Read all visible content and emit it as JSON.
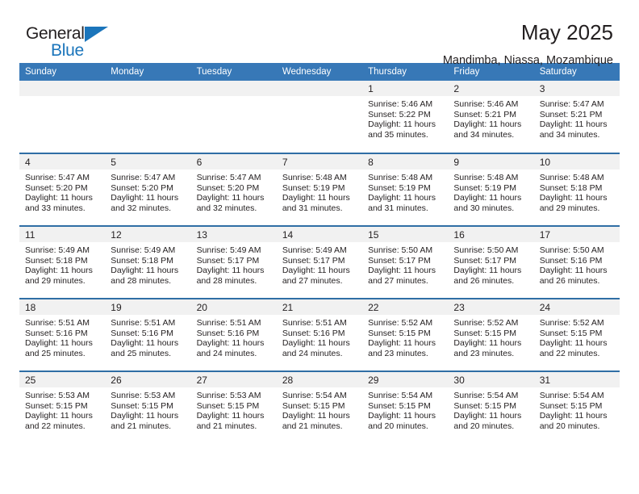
{
  "brand": {
    "name_top": "General",
    "name_bottom": "Blue",
    "accent_color": "#1b75bb"
  },
  "header": {
    "month_title": "May 2025",
    "location": "Mandimba, Niassa, Mozambique"
  },
  "theme": {
    "header_row_bg": "#3778b7",
    "day_number_bg": "#f1f1f1",
    "row_divider": "#2f6ea5",
    "text_color": "#231f20"
  },
  "weekday_headers": [
    "Sunday",
    "Monday",
    "Tuesday",
    "Wednesday",
    "Thursday",
    "Friday",
    "Saturday"
  ],
  "labels": {
    "sunrise_prefix": "Sunrise:",
    "sunset_prefix": "Sunset:",
    "daylight_prefix": "Daylight:"
  },
  "weeks": [
    [
      {
        "day": "",
        "empty": true
      },
      {
        "day": "",
        "empty": true
      },
      {
        "day": "",
        "empty": true
      },
      {
        "day": "",
        "empty": true
      },
      {
        "day": "1",
        "sunrise": "Sunrise: 5:46 AM",
        "sunset": "Sunset: 5:22 PM",
        "daylight": "Daylight: 11 hours and 35 minutes."
      },
      {
        "day": "2",
        "sunrise": "Sunrise: 5:46 AM",
        "sunset": "Sunset: 5:21 PM",
        "daylight": "Daylight: 11 hours and 34 minutes."
      },
      {
        "day": "3",
        "sunrise": "Sunrise: 5:47 AM",
        "sunset": "Sunset: 5:21 PM",
        "daylight": "Daylight: 11 hours and 34 minutes."
      }
    ],
    [
      {
        "day": "4",
        "sunrise": "Sunrise: 5:47 AM",
        "sunset": "Sunset: 5:20 PM",
        "daylight": "Daylight: 11 hours and 33 minutes."
      },
      {
        "day": "5",
        "sunrise": "Sunrise: 5:47 AM",
        "sunset": "Sunset: 5:20 PM",
        "daylight": "Daylight: 11 hours and 32 minutes."
      },
      {
        "day": "6",
        "sunrise": "Sunrise: 5:47 AM",
        "sunset": "Sunset: 5:20 PM",
        "daylight": "Daylight: 11 hours and 32 minutes."
      },
      {
        "day": "7",
        "sunrise": "Sunrise: 5:48 AM",
        "sunset": "Sunset: 5:19 PM",
        "daylight": "Daylight: 11 hours and 31 minutes."
      },
      {
        "day": "8",
        "sunrise": "Sunrise: 5:48 AM",
        "sunset": "Sunset: 5:19 PM",
        "daylight": "Daylight: 11 hours and 31 minutes."
      },
      {
        "day": "9",
        "sunrise": "Sunrise: 5:48 AM",
        "sunset": "Sunset: 5:19 PM",
        "daylight": "Daylight: 11 hours and 30 minutes."
      },
      {
        "day": "10",
        "sunrise": "Sunrise: 5:48 AM",
        "sunset": "Sunset: 5:18 PM",
        "daylight": "Daylight: 11 hours and 29 minutes."
      }
    ],
    [
      {
        "day": "11",
        "sunrise": "Sunrise: 5:49 AM",
        "sunset": "Sunset: 5:18 PM",
        "daylight": "Daylight: 11 hours and 29 minutes."
      },
      {
        "day": "12",
        "sunrise": "Sunrise: 5:49 AM",
        "sunset": "Sunset: 5:18 PM",
        "daylight": "Daylight: 11 hours and 28 minutes."
      },
      {
        "day": "13",
        "sunrise": "Sunrise: 5:49 AM",
        "sunset": "Sunset: 5:17 PM",
        "daylight": "Daylight: 11 hours and 28 minutes."
      },
      {
        "day": "14",
        "sunrise": "Sunrise: 5:49 AM",
        "sunset": "Sunset: 5:17 PM",
        "daylight": "Daylight: 11 hours and 27 minutes."
      },
      {
        "day": "15",
        "sunrise": "Sunrise: 5:50 AM",
        "sunset": "Sunset: 5:17 PM",
        "daylight": "Daylight: 11 hours and 27 minutes."
      },
      {
        "day": "16",
        "sunrise": "Sunrise: 5:50 AM",
        "sunset": "Sunset: 5:17 PM",
        "daylight": "Daylight: 11 hours and 26 minutes."
      },
      {
        "day": "17",
        "sunrise": "Sunrise: 5:50 AM",
        "sunset": "Sunset: 5:16 PM",
        "daylight": "Daylight: 11 hours and 26 minutes."
      }
    ],
    [
      {
        "day": "18",
        "sunrise": "Sunrise: 5:51 AM",
        "sunset": "Sunset: 5:16 PM",
        "daylight": "Daylight: 11 hours and 25 minutes."
      },
      {
        "day": "19",
        "sunrise": "Sunrise: 5:51 AM",
        "sunset": "Sunset: 5:16 PM",
        "daylight": "Daylight: 11 hours and 25 minutes."
      },
      {
        "day": "20",
        "sunrise": "Sunrise: 5:51 AM",
        "sunset": "Sunset: 5:16 PM",
        "daylight": "Daylight: 11 hours and 24 minutes."
      },
      {
        "day": "21",
        "sunrise": "Sunrise: 5:51 AM",
        "sunset": "Sunset: 5:16 PM",
        "daylight": "Daylight: 11 hours and 24 minutes."
      },
      {
        "day": "22",
        "sunrise": "Sunrise: 5:52 AM",
        "sunset": "Sunset: 5:15 PM",
        "daylight": "Daylight: 11 hours and 23 minutes."
      },
      {
        "day": "23",
        "sunrise": "Sunrise: 5:52 AM",
        "sunset": "Sunset: 5:15 PM",
        "daylight": "Daylight: 11 hours and 23 minutes."
      },
      {
        "day": "24",
        "sunrise": "Sunrise: 5:52 AM",
        "sunset": "Sunset: 5:15 PM",
        "daylight": "Daylight: 11 hours and 22 minutes."
      }
    ],
    [
      {
        "day": "25",
        "sunrise": "Sunrise: 5:53 AM",
        "sunset": "Sunset: 5:15 PM",
        "daylight": "Daylight: 11 hours and 22 minutes."
      },
      {
        "day": "26",
        "sunrise": "Sunrise: 5:53 AM",
        "sunset": "Sunset: 5:15 PM",
        "daylight": "Daylight: 11 hours and 21 minutes."
      },
      {
        "day": "27",
        "sunrise": "Sunrise: 5:53 AM",
        "sunset": "Sunset: 5:15 PM",
        "daylight": "Daylight: 11 hours and 21 minutes."
      },
      {
        "day": "28",
        "sunrise": "Sunrise: 5:54 AM",
        "sunset": "Sunset: 5:15 PM",
        "daylight": "Daylight: 11 hours and 21 minutes."
      },
      {
        "day": "29",
        "sunrise": "Sunrise: 5:54 AM",
        "sunset": "Sunset: 5:15 PM",
        "daylight": "Daylight: 11 hours and 20 minutes."
      },
      {
        "day": "30",
        "sunrise": "Sunrise: 5:54 AM",
        "sunset": "Sunset: 5:15 PM",
        "daylight": "Daylight: 11 hours and 20 minutes."
      },
      {
        "day": "31",
        "sunrise": "Sunrise: 5:54 AM",
        "sunset": "Sunset: 5:15 PM",
        "daylight": "Daylight: 11 hours and 20 minutes."
      }
    ]
  ]
}
